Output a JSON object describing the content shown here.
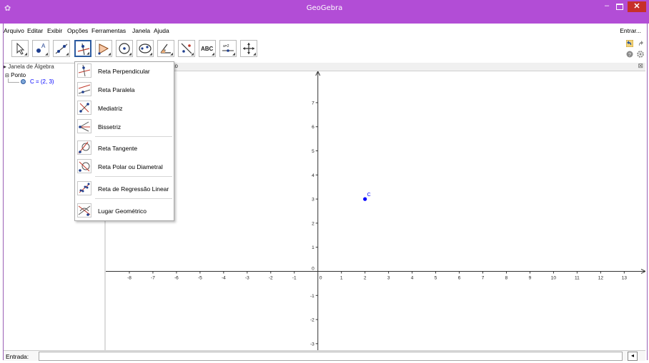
{
  "window": {
    "title": "GeoGebra",
    "app_icon": "geogebra-icon",
    "minimize": "–",
    "close": "✕"
  },
  "menubar": {
    "items": [
      "Arquivo",
      "Editar",
      "Exibir",
      "Opções",
      "Ferramentas",
      "Janela",
      "Ajuda"
    ],
    "signin": "Entrar..."
  },
  "toolbar": {
    "tools": [
      "move-tool",
      "point-tool",
      "line-tool",
      "perpendicular-line-tool",
      "polygon-tool",
      "circle-tool",
      "ellipse-tool",
      "angle-tool",
      "reflect-tool",
      "text-tool",
      "slider-tool",
      "move-graphics-tool"
    ],
    "text_tool_label": "ABC",
    "slider_tool_label": "a=2",
    "right_icons": [
      "undo-icon",
      "redo-icon",
      "help-icon",
      "settings-icon"
    ]
  },
  "algebra": {
    "header": "Janela de Álgebra",
    "folder": "Ponto",
    "objects": [
      {
        "label": "C = (2, 3)",
        "color": "#0000ff"
      }
    ]
  },
  "graphics": {
    "header_suffix": "ão",
    "close_icon": "⊠",
    "point": {
      "name": "C",
      "x": 2,
      "y": 3,
      "color": "#0000ff"
    },
    "x_ticks": [
      -8,
      -7,
      -6,
      -5,
      -4,
      -3,
      -2,
      -1,
      0,
      1,
      2,
      3,
      4,
      5,
      6,
      7,
      8,
      9,
      10,
      11,
      12,
      13
    ],
    "y_ticks": [
      -3,
      -2,
      -1,
      1,
      2,
      3,
      4,
      5,
      6,
      7
    ],
    "x_range": [
      -9,
      13.9
    ],
    "y_range": [
      -3.3,
      8.3
    ]
  },
  "dropdown": {
    "items": [
      {
        "label": "Reta Perpendicular",
        "icon": "perpendicular-line-icon"
      },
      {
        "label": "Reta Paralela",
        "icon": "parallel-line-icon"
      },
      {
        "label": "Mediatriz",
        "icon": "perpendicular-bisector-icon"
      },
      {
        "label": "Bissetriz",
        "icon": "angle-bisector-icon"
      },
      {
        "label": "Reta Tangente",
        "icon": "tangent-line-icon"
      },
      {
        "label": "Reta Polar ou Diametral",
        "icon": "polar-line-icon"
      },
      {
        "label": "Reta de Regressão Linear",
        "icon": "regression-line-icon"
      },
      {
        "label": "Lugar Geométrico",
        "icon": "locus-icon"
      }
    ]
  },
  "inputbar": {
    "label": "Entrada:",
    "value": "",
    "keyboard_icon": "◂"
  },
  "colors": {
    "titlebar": "#b24dd6",
    "accent": "#2c5aa0",
    "point": "#0000ff",
    "close": "#c7302a"
  }
}
